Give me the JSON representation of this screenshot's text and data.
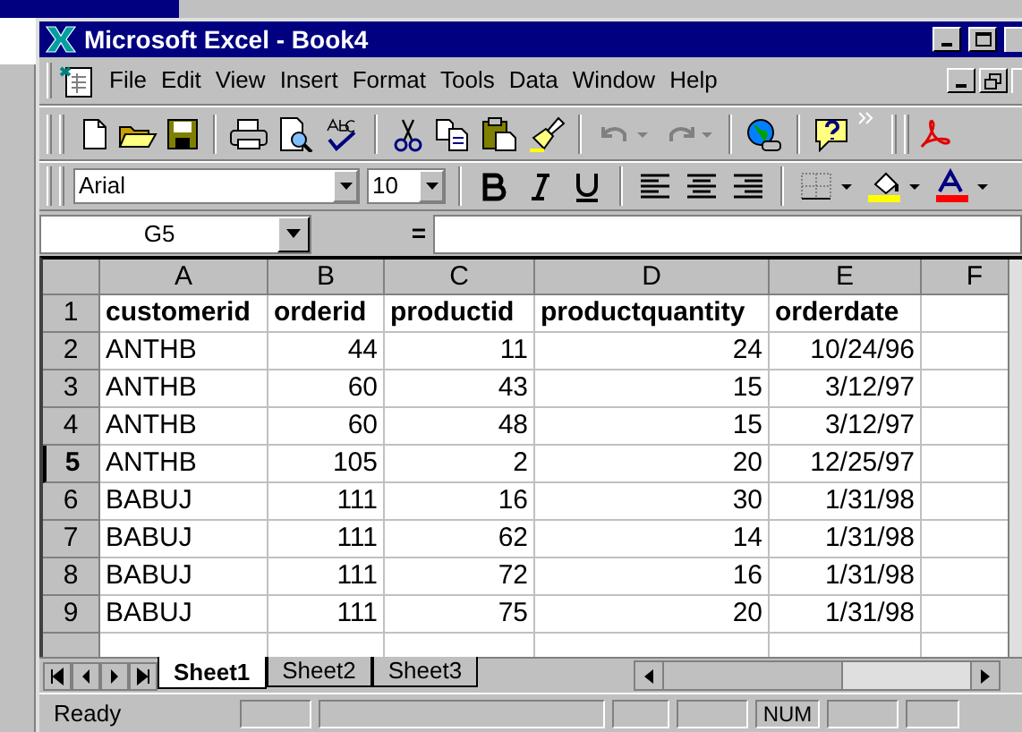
{
  "window": {
    "title": "Microsoft Excel - Book4"
  },
  "menu": [
    "File",
    "Edit",
    "View",
    "Insert",
    "Format",
    "Tools",
    "Data",
    "Window",
    "Help"
  ],
  "formatting": {
    "font": "Arial",
    "size": "10"
  },
  "formula_bar": {
    "name_box": "G5",
    "equals": "="
  },
  "columns": [
    {
      "label": "A",
      "kind": "text"
    },
    {
      "label": "B",
      "kind": "number"
    },
    {
      "label": "C",
      "kind": "number"
    },
    {
      "label": "D",
      "kind": "number"
    },
    {
      "label": "E",
      "kind": "number"
    },
    {
      "label": "F"
    }
  ],
  "rows": [
    {
      "header": "1",
      "selected": false,
      "kind": "header",
      "cells": [
        "customerid",
        "orderid",
        "productid",
        "productquantity",
        "orderdate"
      ]
    },
    {
      "header": "2",
      "selected": false,
      "kind": "data",
      "cells": [
        "ANTHB",
        "44",
        "11",
        "24",
        "10/24/96"
      ]
    },
    {
      "header": "3",
      "selected": false,
      "kind": "data",
      "cells": [
        "ANTHB",
        "60",
        "43",
        "15",
        "3/12/97"
      ]
    },
    {
      "header": "4",
      "selected": false,
      "kind": "data",
      "cells": [
        "ANTHB",
        "60",
        "48",
        "15",
        "3/12/97"
      ]
    },
    {
      "header": "5",
      "selected": true,
      "kind": "data",
      "cells": [
        "ANTHB",
        "105",
        "2",
        "20",
        "12/25/97"
      ]
    },
    {
      "header": "6",
      "selected": false,
      "kind": "data",
      "cells": [
        "BABUJ",
        "111",
        "16",
        "30",
        "1/31/98"
      ]
    },
    {
      "header": "7",
      "selected": false,
      "kind": "data",
      "cells": [
        "BABUJ",
        "111",
        "62",
        "14",
        "1/31/98"
      ]
    },
    {
      "header": "8",
      "selected": false,
      "kind": "data",
      "cells": [
        "BABUJ",
        "111",
        "72",
        "16",
        "1/31/98"
      ]
    },
    {
      "header": "9",
      "selected": false,
      "kind": "data",
      "cells": [
        "BABUJ",
        "111",
        "75",
        "20",
        "1/31/98"
      ]
    }
  ],
  "sheet_tabs": [
    {
      "label": "Sheet1",
      "selected": true
    },
    {
      "label": "Sheet2",
      "selected": false
    },
    {
      "label": "Sheet3",
      "selected": false
    }
  ],
  "status_bar": {
    "mode": "Ready",
    "indicator": "NUM"
  }
}
